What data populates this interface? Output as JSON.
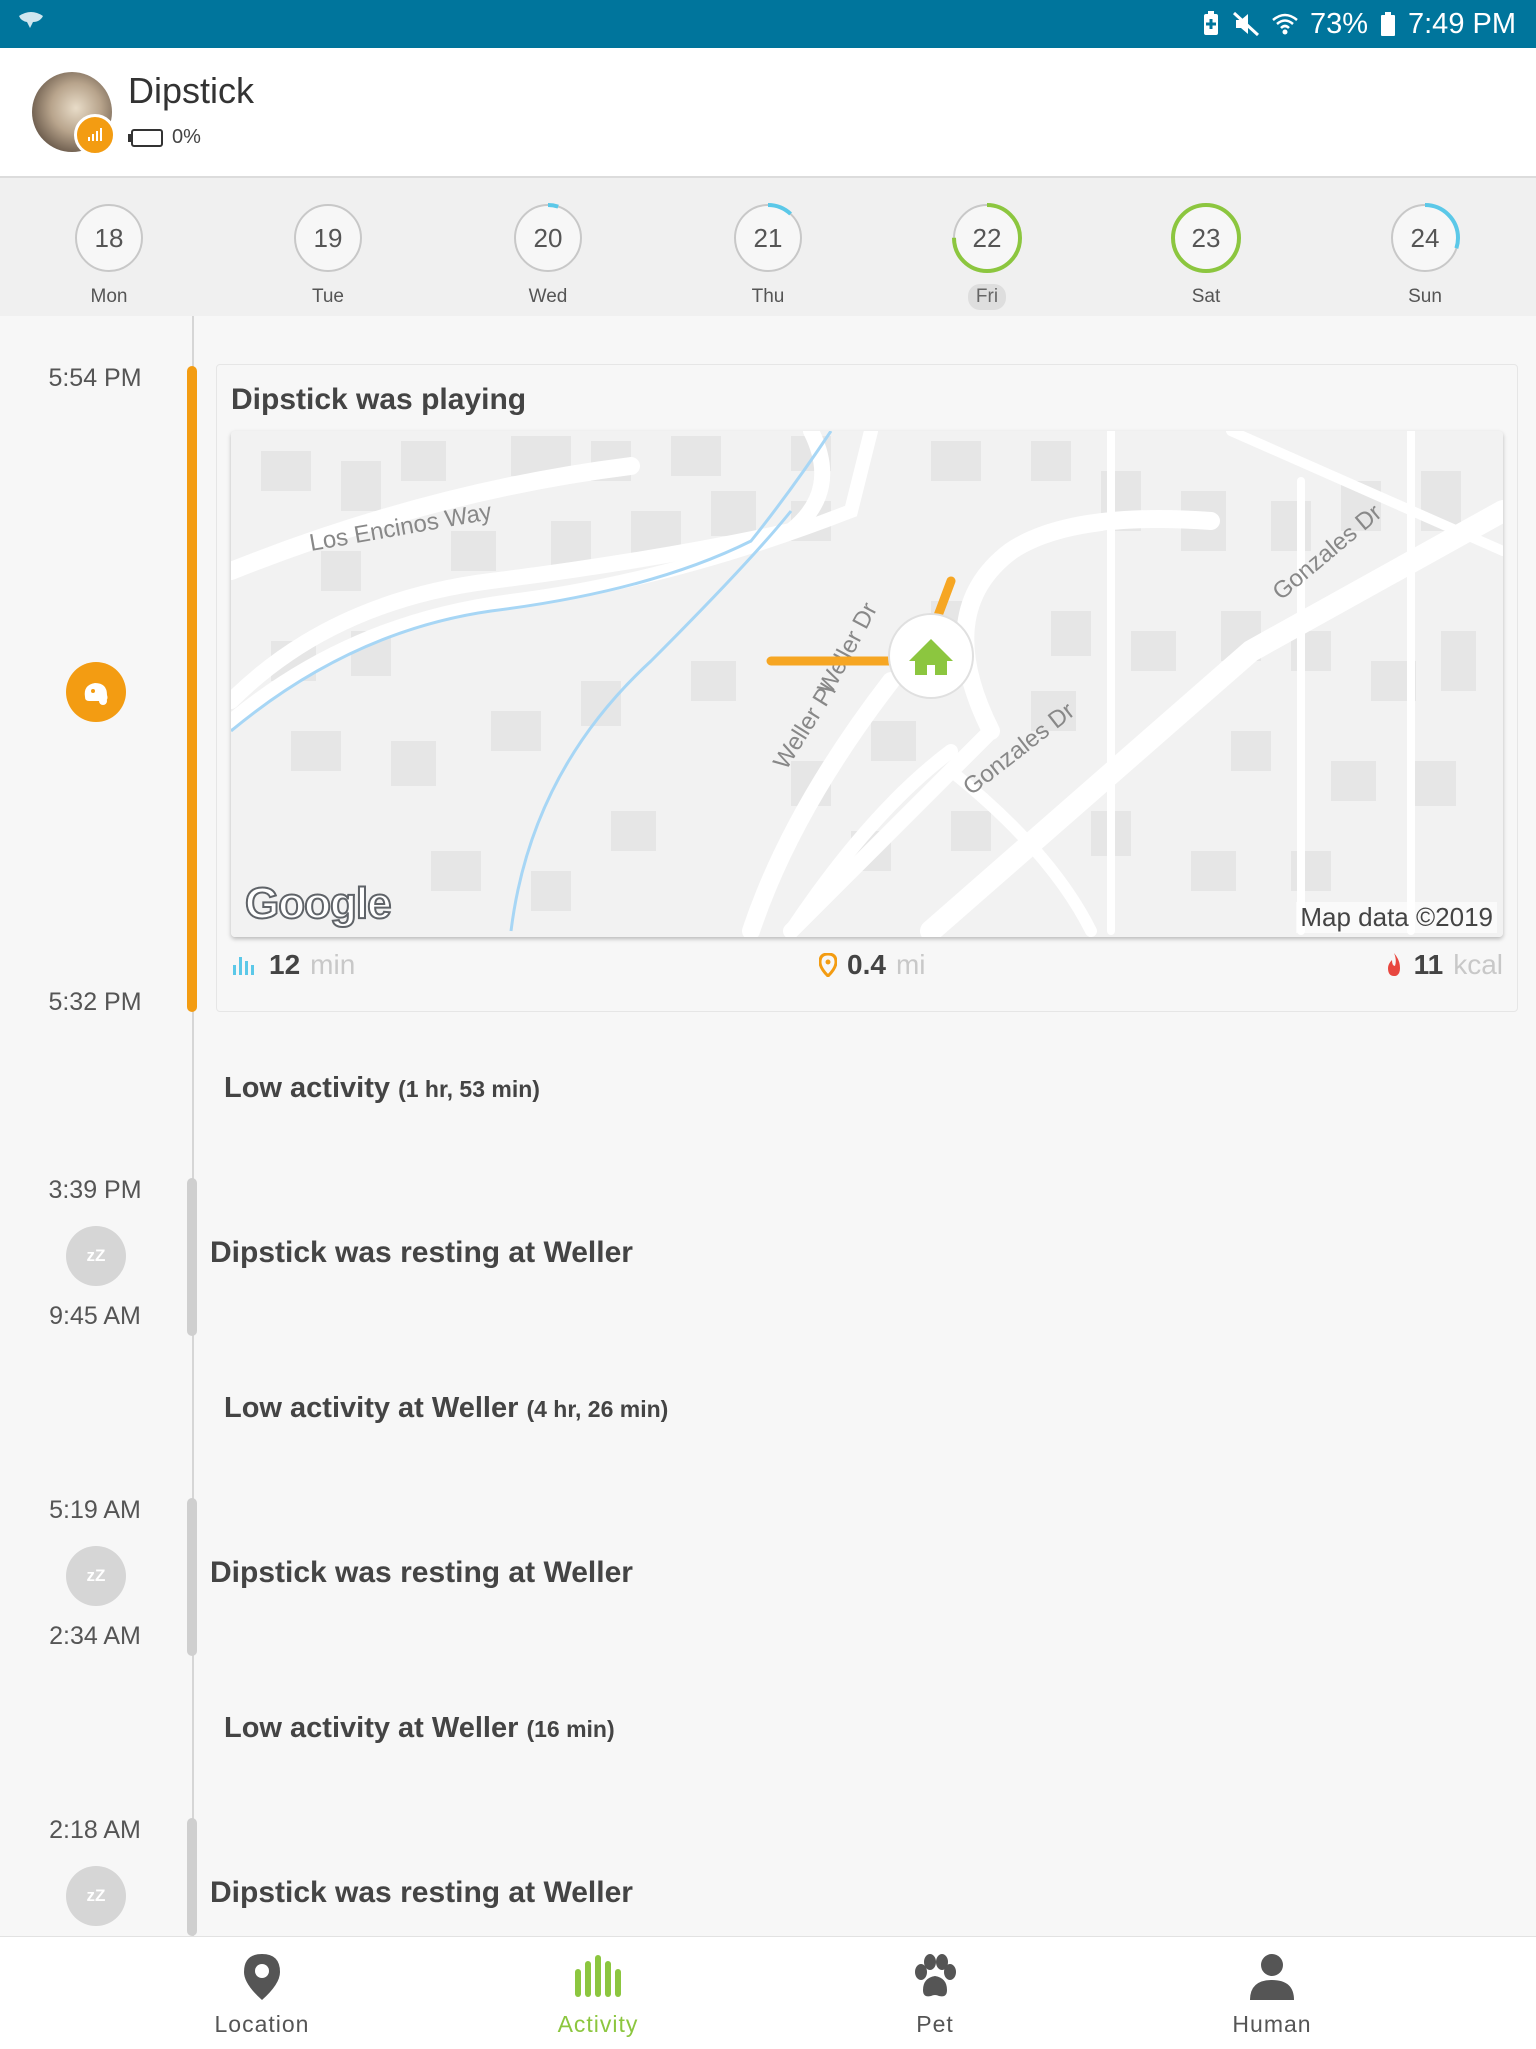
{
  "status_bar": {
    "battery_percent": "73%",
    "time": "7:49 PM",
    "icons": [
      "app-notification-icon",
      "battery-saver-icon",
      "mute-icon",
      "wifi-icon",
      "battery-icon"
    ]
  },
  "header": {
    "pet_name": "Dipstick",
    "tracker_battery": "0%"
  },
  "days": [
    {
      "num": "18",
      "label": "Mon",
      "ring": 0.0
    },
    {
      "num": "19",
      "label": "Tue",
      "ring": 0.0
    },
    {
      "num": "20",
      "label": "Wed",
      "ring": 0.05
    },
    {
      "num": "21",
      "label": "Thu",
      "ring": 0.12
    },
    {
      "num": "22",
      "label": "Fri",
      "ring": 0.75,
      "selected": true
    },
    {
      "num": "23",
      "label": "Sat",
      "ring": 1.0
    },
    {
      "num": "24",
      "label": "Sun",
      "ring": 0.3
    }
  ],
  "timeline": {
    "playing": {
      "start_time": "5:54 PM",
      "end_time": "5:32 PM",
      "title": "Dipstick was playing",
      "map": {
        "streets": [
          "Los Encinos Way",
          "Gonzales Dr",
          "Gonzales Dr",
          "Weller Dr",
          "Weller Pl"
        ],
        "attribution": "Map data ©2019",
        "logo": "Google"
      },
      "stats": {
        "duration_value": "12",
        "duration_unit": "min",
        "distance_value": "0.4",
        "distance_unit": "mi",
        "calories_value": "11",
        "calories_unit": "kcal"
      }
    },
    "low1": {
      "text": "Low activity",
      "duration": "(1 hr, 53 min)"
    },
    "rest1": {
      "start": "3:39 PM",
      "end": "9:45 AM",
      "text": "Dipstick was resting at Weller"
    },
    "low2": {
      "text": "Low activity at Weller",
      "duration": "(4 hr, 26 min)"
    },
    "rest2": {
      "start": "5:19 AM",
      "end": "2:34 AM",
      "text": "Dipstick was resting at Weller"
    },
    "low3": {
      "text": "Low activity at Weller",
      "duration": "(16 min)"
    },
    "rest3": {
      "start": "2:18 AM",
      "text": "Dipstick was resting at Weller"
    },
    "sleep_icon_text": "zZ"
  },
  "bottom_nav": {
    "items": [
      {
        "label": "Location",
        "icon": "location-pin-icon"
      },
      {
        "label": "Activity",
        "icon": "activity-bars-icon",
        "active": true
      },
      {
        "label": "Pet",
        "icon": "paw-icon"
      },
      {
        "label": "Human",
        "icon": "person-icon"
      }
    ]
  },
  "colors": {
    "status_bar": "#00759c",
    "orange": "#f39c12",
    "green": "#8cc63f",
    "ring_blue": "#5bc8e8"
  }
}
